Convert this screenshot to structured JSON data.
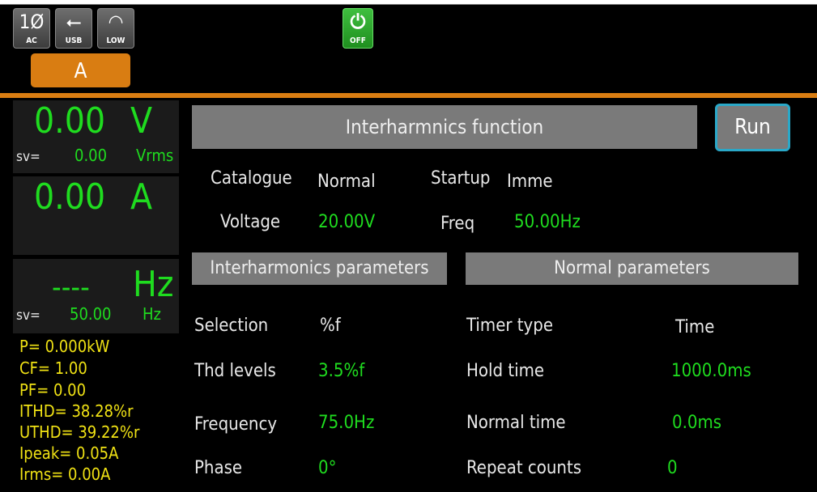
{
  "status": {
    "phase_glyph": "1Ø",
    "phase_caption": "AC",
    "usb_glyph": "⭠",
    "usb_caption": "USB",
    "range_glyph": "◠",
    "range_caption": "LOW",
    "power_caption": "OFF"
  },
  "channel_tab": "A",
  "meters": {
    "voltage": {
      "value": "0.00",
      "unit": "V",
      "sv_label": "sv=",
      "sv_value": "0.00",
      "sv_unit": "Vrms"
    },
    "current": {
      "value": "0.00",
      "unit": "A"
    },
    "frequency": {
      "value": "----",
      "unit": "Hz",
      "sv_label": "sv=",
      "sv_value": "50.00",
      "sv_unit": "Hz"
    }
  },
  "stats": [
    "P= 0.000kW",
    "CF= 1.00",
    "PF= 0.00",
    "ITHD= 38.28%r",
    "UTHD= 39.22%r",
    "Ipeak= 0.05A",
    "Irms= 0.00A"
  ],
  "function": {
    "title": "Interharmnics function",
    "run_label": "Run",
    "catalogue_label": "Catalogue",
    "catalogue_value": "Normal",
    "startup_label": "Startup",
    "startup_value": "Imme",
    "voltage_label": "Voltage",
    "voltage_value": "20.00V",
    "freq_label": "Freq",
    "freq_value": "50.00Hz"
  },
  "interharmonics": {
    "title": "Interharmonics parameters",
    "selection_label": "Selection",
    "selection_value": "%f",
    "thd_label": "Thd levels",
    "thd_value": "3.5%f",
    "frequency_label": "Frequency",
    "frequency_value": "75.0Hz",
    "phase_label": "Phase",
    "phase_value": "0°"
  },
  "normal": {
    "title": "Normal parameters",
    "timer_type_label": "Timer type",
    "timer_type_value": "Time",
    "hold_time_label": "Hold time",
    "hold_time_value": "1000.0ms",
    "normal_time_label": "Normal time",
    "normal_time_value": "0.0ms",
    "repeat_label": "Repeat counts",
    "repeat_value": "0"
  },
  "colors": {
    "accent": "#d97d12",
    "value_green": "#1fdc1f",
    "stat_yellow": "#f0e214",
    "bar_gray": "#7a7a7a",
    "run_border": "#2aa8c8",
    "power_green": "#2fa82f"
  }
}
